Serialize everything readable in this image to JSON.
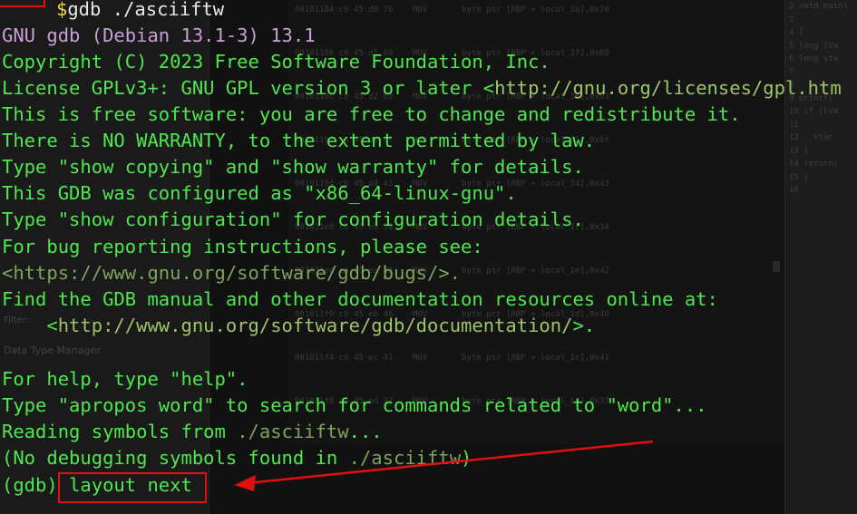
{
  "prompt": {
    "dollar": "$",
    "command": "gdb ./asciiftw"
  },
  "banner": {
    "version": "GNU gdb (Debian 13.1-3) 13.1",
    "copyright": "Copyright (C) 2023 Free Software Foundation, Inc.",
    "license_prefix": "License GPLv3+: GNU GPL version 3 or later <",
    "license_url": "http://gnu.org/licenses/gpl.htm",
    "free_software": "This is free software: you are free to change and redistribute it.",
    "warranty": "There is NO WARRANTY, to the extent permitted by law.",
    "show_copying": "Type \"show copying\" and \"show warranty\" for details.",
    "configured": "This GDB was configured as \"x86_64-linux-gnu\".",
    "show_config": "Type \"show configuration\" for configuration details.",
    "bug_report": "For bug reporting instructions, please see:",
    "bugs_url": "<https://www.gnu.org/software/gdb/bugs/>.",
    "manual": "Find the GDB manual and other documentation resources online at:",
    "doc_url_pre": "    <",
    "doc_url": "http://www.gnu.org/software/gdb/documentation/",
    "doc_url_post": ">.",
    "help": "For help, type \"help\".",
    "apropos": "Type \"apropos word\" to search for commands related to \"word\"...",
    "reading_prefix": "Reading symbols from ",
    "reading_file": "./asciiftw",
    "reading_suffix": "...",
    "no_debug_prefix": "(No debugging symbols found in ",
    "no_debug_file": "./asciiftw",
    "no_debug_suffix": ")"
  },
  "gdb_prompt": {
    "label": "(gdb) ",
    "input": "layout next"
  },
  "background": {
    "panel_title": "Data Type Manager",
    "filter_label": "Filter:",
    "listing_rows": [
      "00101184 c6 45 d0 70    MOV       byte ptr [RBP + local_3a],0x70",
      "00101188 c6 45 d1 69    MOV       byte ptr [RBP + local_37],0x69",
      "0010118c c6 45 d2 63    MOV       byte ptr [RBP + local_36],0x63",
      "00101190 c6 45 d3 6f    MOV       byte ptr [RBP + local_35],0x6f",
      "00101194 c6 45 d4 43    MOV       byte ptr [RBP + local_34],0x43",
      "001011e8 c6 45 e9 34    MOV       byte ptr [RBP + local_1f],0x34",
      "001011ec c6 45 ea 42    MOV       byte ptr [RBP + local_1e],0x42",
      "001011f0 c6 45 eb 46    MOV       byte ptr [RBP + local_1d],0x46",
      "001011f4 c6 45 ec 41    MOV       byte ptr [RBP + local_1c],0x41",
      "001011f8 c6 45 ed 37    MOV       byte ptr [RBP + local_1a],0x37"
    ],
    "code_lines": [
      "2 void main(",
      "3",
      "4 {",
      "5   long lVa",
      "6   long sta",
      "7",
      "8",
      "9   printf(",
      "10  if (lVa",
      "11",
      "12    __stac",
      "13  }",
      "14  return;",
      "15 }",
      "16"
    ]
  }
}
